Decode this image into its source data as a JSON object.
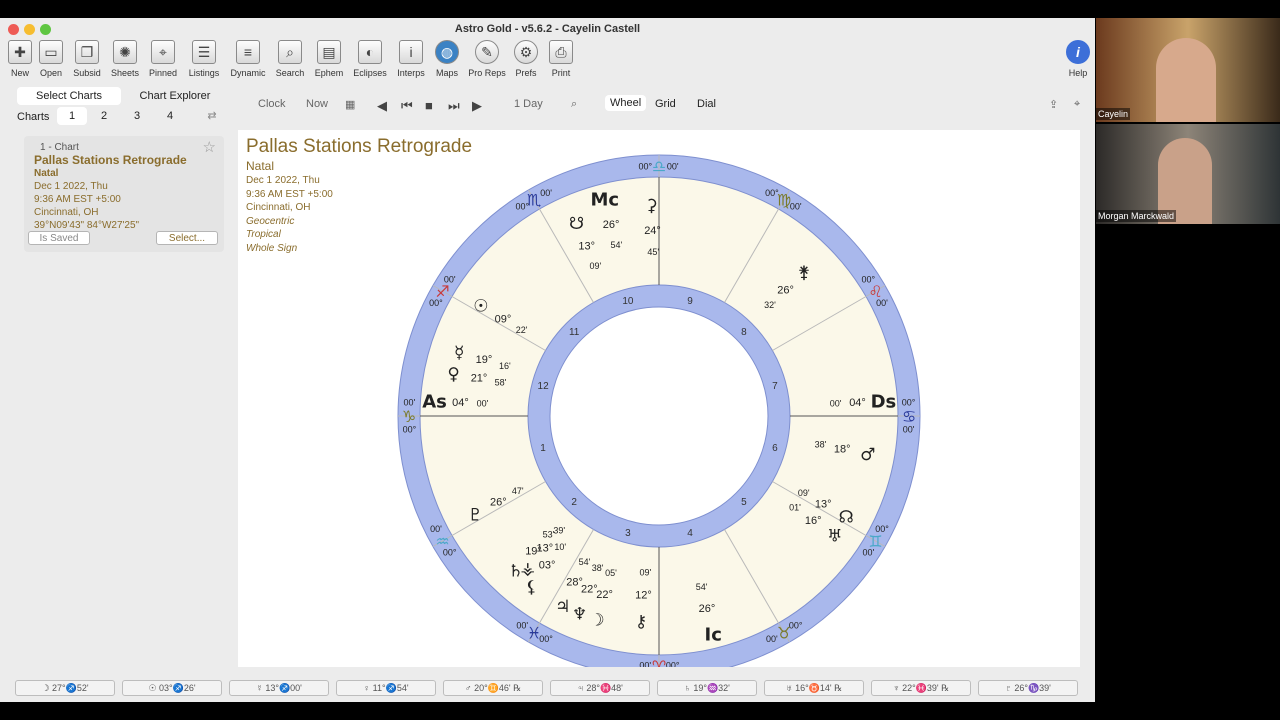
{
  "window": {
    "title": "Astro Gold - v5.6.2 - Cayelin Castell"
  },
  "toolbar": {
    "buttons": [
      {
        "label": "New",
        "icon": "new-chart-icon"
      },
      {
        "label": "Open",
        "icon": "open-icon"
      },
      {
        "label": "Subsid",
        "icon": "subsid-icon"
      },
      {
        "label": "Sheets",
        "icon": "sheets-icon"
      },
      {
        "label": "Pinned",
        "icon": "pin-icon"
      },
      {
        "label": "Listings",
        "icon": "listings-icon"
      },
      {
        "label": "Dynamic",
        "icon": "dynamic-icon"
      },
      {
        "label": "Search",
        "icon": "search-icon"
      },
      {
        "label": "Ephem",
        "icon": "ephem-icon"
      },
      {
        "label": "Eclipses",
        "icon": "eclipses-icon"
      },
      {
        "label": "Interps",
        "icon": "interps-icon"
      },
      {
        "label": "Maps",
        "icon": "globe-icon"
      },
      {
        "label": "Pro Reps",
        "icon": "pro-reps-icon"
      },
      {
        "label": "Prefs",
        "icon": "gear-icon"
      },
      {
        "label": "Print",
        "icon": "printer-icon"
      }
    ],
    "help_label": "Help"
  },
  "sidebar": {
    "tabs": [
      "Select Charts",
      "Chart Explorer"
    ],
    "charts_label": "Charts",
    "chart_slots": [
      "1",
      "2",
      "3",
      "4"
    ],
    "card": {
      "slot": "1 - Chart",
      "name": "Pallas Stations Retrograde",
      "type": "Natal",
      "date": "Dec 1 2022, Thu",
      "time": "9:36 AM EST +5:00",
      "place": "Cincinnati, OH",
      "coords": "39°N09'43\" 84°W27'25\"",
      "saved_label": "Is Saved",
      "select_label": "Select..."
    }
  },
  "controls": {
    "clock_label": "Clock",
    "now_label": "Now",
    "step_label": "1 Day",
    "views": [
      "Wheel",
      "Grid",
      "Dial"
    ]
  },
  "chart": {
    "title": "Pallas Stations Retrograde",
    "type": "Natal",
    "date": "Dec 1 2022, Thu",
    "time": "9:36 AM EST +5:00",
    "place": "Cincinnati, OH",
    "system1": "Geocentric",
    "system2": "Tropical",
    "system3": "Whole Sign"
  },
  "wheel": {
    "sign_ring_labels": [
      "00°",
      "00'"
    ],
    "houses": [
      "1",
      "2",
      "3",
      "4",
      "5",
      "6",
      "7",
      "8",
      "9",
      "10",
      "11",
      "12"
    ],
    "points": [
      {
        "glyph": "As",
        "deg": "04°",
        "min": "00'"
      },
      {
        "glyph": "Ds",
        "deg": "04°",
        "min": "00'"
      },
      {
        "glyph": "Mc",
        "deg": "26°",
        "min": "54'"
      },
      {
        "glyph": "Ic",
        "deg": "26°",
        "min": "54'"
      },
      {
        "glyph": "☉",
        "deg": "09°",
        "min": "22'"
      },
      {
        "glyph": "☿",
        "deg": "19°",
        "min": "16'"
      },
      {
        "glyph": "♀",
        "deg": "21°",
        "min": "58'"
      },
      {
        "glyph": "♇",
        "deg": "26°",
        "min": "47'"
      },
      {
        "glyph": "♄",
        "deg": "19°",
        "min": "53'"
      },
      {
        "glyph": "♂",
        "deg": "18°",
        "min": "38'"
      },
      {
        "glyph": "☊",
        "deg": "13°",
        "min": "09'"
      },
      {
        "glyph": "☋",
        "deg": "13°",
        "min": "09'"
      },
      {
        "glyph": "⚳",
        "deg": "24°",
        "min": "45'"
      },
      {
        "glyph": "⚵",
        "deg": "26°",
        "min": "32'"
      },
      {
        "glyph": "♅",
        "deg": "16°",
        "min": "01'"
      },
      {
        "glyph": "⚷",
        "deg": "12°",
        "min": "09'"
      },
      {
        "glyph": "☽",
        "deg": "22°",
        "min": "05'"
      },
      {
        "glyph": "♆",
        "deg": "22°",
        "min": "38'"
      },
      {
        "glyph": "♃",
        "deg": "28°",
        "min": "54'"
      },
      {
        "glyph": "⚸",
        "deg": "03°",
        "min": "10'"
      },
      {
        "glyph": "⚶",
        "deg": "13°",
        "min": "39'"
      }
    ]
  },
  "statusbar": [
    "☽ 27°♐52'",
    "☉ 03°♐26'",
    "☿ 13°♐00'",
    "♀ 11°♐54'",
    "♂ 20°♊46' ℞",
    "♃ 28°♓48'",
    "♄ 19°♒32'",
    "♅ 16°♉14' ℞",
    "♆ 22°♓39' ℞",
    "♇ 26°♑39'"
  ],
  "video": {
    "participant1": "Cayelin",
    "participant2": "Morgan Marckwald"
  },
  "colors": {
    "ring": "#a9b8ec",
    "house_fill": "#fbf8e9",
    "title": "#8a6d2d"
  }
}
